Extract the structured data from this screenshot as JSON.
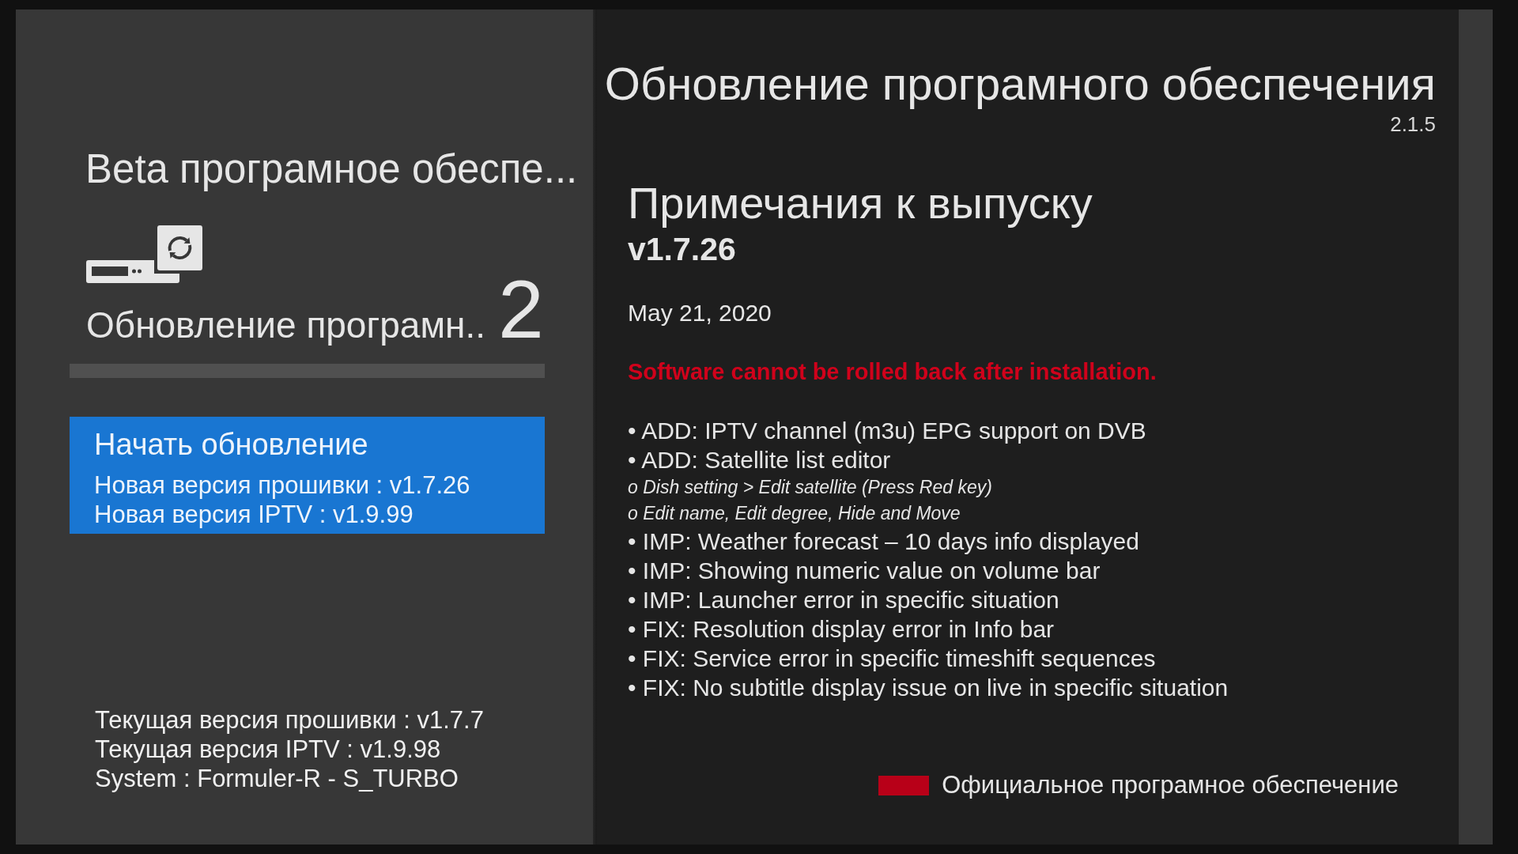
{
  "left_panel": {
    "title": "Beta програмное обеспе...",
    "update": {
      "label": "Обновление програмн..",
      "count": "2"
    },
    "progress": {
      "level": 0
    },
    "start_button": {
      "label": "Начать обновление",
      "selected": true,
      "lines": [
        "Новая версия прошивки : v1.7.26",
        "Новая версия IPTV : v1.9.99"
      ]
    },
    "info": [
      "Текущая версия прошивки : v1.7.7",
      "Текущая версия IPTV : v1.9.98",
      "System : Formuler-R - S_TURBO"
    ]
  },
  "right_panel": {
    "title": "Обновление програмного обеспечения",
    "app_version": "2.1.5",
    "notes": {
      "heading": "Примечания к выпуску",
      "version": "v1.7.26",
      "date": "May 21, 2020",
      "warning": "Software cannot be rolled back after installation.",
      "items": [
        {
          "kind": "bullet",
          "text": "• ADD: IPTV channel (m3u) EPG support on DVB"
        },
        {
          "kind": "bullet",
          "text": "• ADD: Satellite list editor"
        },
        {
          "kind": "sub",
          "text": "o Dish setting > Edit satellite (Press Red key)"
        },
        {
          "kind": "sub",
          "text": "o Edit name, Edit degree, Hide and Move"
        },
        {
          "kind": "bullet",
          "text": "• IMP: Weather forecast – 10 days info displayed"
        },
        {
          "kind": "bullet",
          "text": "• IMP: Showing numeric value on volume bar"
        },
        {
          "kind": "bullet",
          "text": "• IMP: Launcher error in specific situation"
        },
        {
          "kind": "bullet",
          "text": "• FIX: Resolution display error in Info bar"
        },
        {
          "kind": "bullet",
          "text": "• FIX: Service error in specific timeshift sequences"
        },
        {
          "kind": "bullet",
          "text": "• FIX: No subtitle display issue on live in specific situation"
        }
      ]
    },
    "legend": {
      "label": "Официальное програмное обеспечение",
      "color": "#b80018"
    }
  }
}
